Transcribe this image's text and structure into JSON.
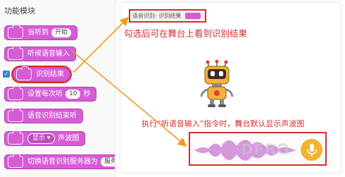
{
  "palette": {
    "title": "功能模块",
    "blocks": [
      {
        "label": "当听到",
        "pill": "开始"
      },
      {
        "label": "听候语音输入"
      },
      {
        "label": "识别结果"
      },
      {
        "label": "设置每次听",
        "pill": "10",
        "suffix": "秒"
      },
      {
        "label": "语音识别结束听"
      },
      {
        "label": "声波图",
        "dropdown": "显示 ▾"
      },
      {
        "label": "切换语音识别服务器为",
        "pill": "服务"
      }
    ],
    "checkbox_checked": true
  },
  "stage": {
    "monitor_label": "语音识别: 识别结果",
    "note_top": "勾选后可在舞台上看到识别结果",
    "note_bottom": "执行“听语音输入”指令时，舞台默认显示声波图"
  },
  "colors": {
    "block": "#d65cd6",
    "highlight": "#d32f2f",
    "arrow": "#f29a1f",
    "wave": "#d48bd9",
    "mic": "#f0b430"
  },
  "icons": {
    "mic": "microphone-icon",
    "check": "checkmark-icon"
  }
}
